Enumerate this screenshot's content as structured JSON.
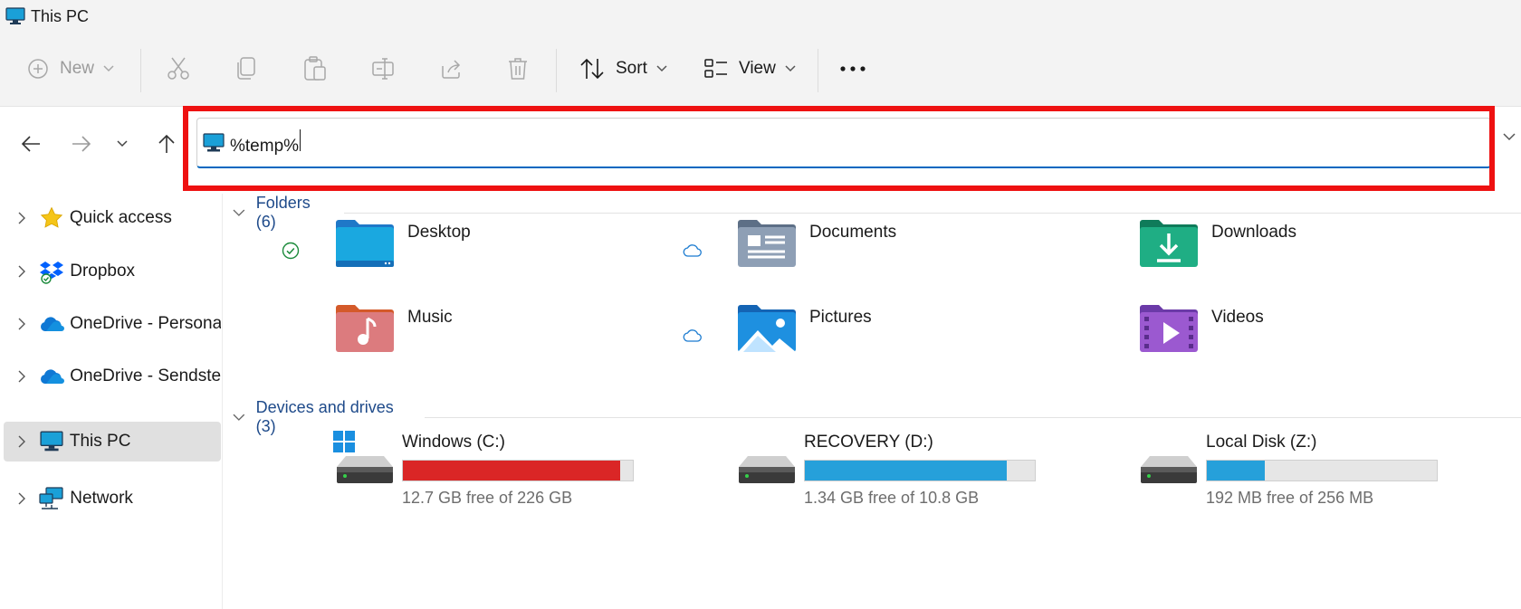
{
  "window": {
    "title": "This PC"
  },
  "toolbar": {
    "new_label": "New",
    "sort_label": "Sort",
    "view_label": "View"
  },
  "address": {
    "value": "%temp%"
  },
  "sidebar": {
    "items": [
      {
        "label": "Quick access",
        "icon": "star-icon"
      },
      {
        "label": "Dropbox",
        "icon": "dropbox-icon"
      },
      {
        "label": "OneDrive - Personal",
        "icon": "onedrive-icon"
      },
      {
        "label": "OneDrive - Sendstep",
        "icon": "onedrive-icon"
      },
      {
        "label": "This PC",
        "icon": "pc-icon",
        "selected": true
      },
      {
        "label": "Network",
        "icon": "network-icon"
      }
    ]
  },
  "folders": {
    "header": "Folders (6)",
    "items": [
      {
        "name": "Desktop",
        "status": "synced-check"
      },
      {
        "name": "Documents",
        "status": "cloud"
      },
      {
        "name": "Downloads",
        "status": ""
      },
      {
        "name": "Music",
        "status": ""
      },
      {
        "name": "Pictures",
        "status": "cloud"
      },
      {
        "name": "Videos",
        "status": ""
      }
    ]
  },
  "drives": {
    "header": "Devices and drives (3)",
    "items": [
      {
        "name": "Windows (C:)",
        "free_text": "12.7 GB free of 226 GB",
        "used_fraction": 0.944,
        "bar_color": "#da2626"
      },
      {
        "name": "RECOVERY (D:)",
        "free_text": "1.34 GB free of 10.8 GB",
        "used_fraction": 0.876,
        "bar_color": "#26a0da"
      },
      {
        "name": "Local Disk (Z:)",
        "free_text": "192 MB free of 256 MB",
        "used_fraction": 0.25,
        "bar_color": "#26a0da"
      }
    ]
  },
  "colors": {
    "accent": "#0067c0",
    "highlight": "#ee1111",
    "link": "#1e4a8a"
  }
}
